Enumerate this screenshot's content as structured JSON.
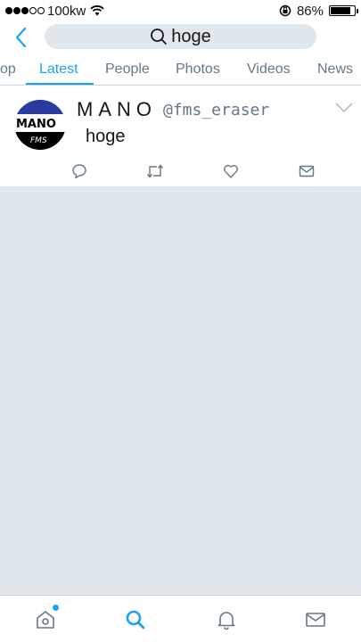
{
  "status_bar": {
    "carrier": "100kw",
    "signal_bars_filled": 3,
    "signal_bars_total": 5,
    "battery_percent": "86%",
    "battery_level": 0.86
  },
  "header": {
    "search_query": "hoge",
    "back_icon": "chevron-left-icon",
    "search_icon": "search-icon"
  },
  "tabs": [
    {
      "label": "op",
      "active": false
    },
    {
      "label": "Latest",
      "active": true
    },
    {
      "label": "People",
      "active": false
    },
    {
      "label": "Photos",
      "active": false
    },
    {
      "label": "Videos",
      "active": false
    },
    {
      "label": "News",
      "active": false
    }
  ],
  "tweet": {
    "display_name": "MANO",
    "handle": "@fms_eraser",
    "text": "hoge",
    "avatar_text": "MANO",
    "avatar_subtext": "FMS",
    "actions": [
      "reply-icon",
      "retweet-icon",
      "like-icon",
      "direct-message-icon"
    ]
  },
  "bottom_nav": {
    "items": [
      "home-icon",
      "search-icon",
      "notifications-icon",
      "messages-icon"
    ],
    "active": "search-icon"
  },
  "colors": {
    "accent": "#1da1f2",
    "muted": "#657786",
    "background": "#e1e8ed",
    "text": "#14171a"
  }
}
